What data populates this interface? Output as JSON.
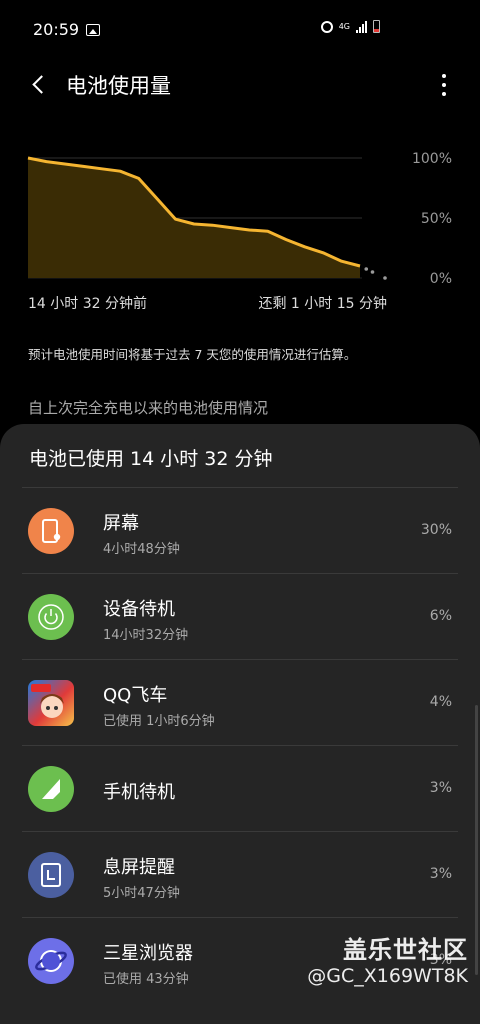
{
  "status_bar": {
    "time": "20:59",
    "network": "4G"
  },
  "header": {
    "title": "电池使用量"
  },
  "chart": {
    "y_labels": [
      "100%",
      "50%",
      "0%"
    ],
    "start_label": "14 小时 32 分钟前",
    "end_label": "还剩 1 小时 15 分钟"
  },
  "chart_data": {
    "type": "line",
    "title": "",
    "xlabel": "",
    "ylabel": "",
    "ylim": [
      0,
      100
    ],
    "x_range_labels": [
      "14 小时 32 分钟前",
      "还剩 1 小时 15 分钟"
    ],
    "series": [
      {
        "values": [
          100,
          97,
          95,
          93,
          91,
          89,
          83,
          66,
          49,
          45,
          44,
          42,
          40,
          39,
          32,
          26,
          21,
          14,
          10
        ]
      },
      {
        "projected_values": [
          10,
          5,
          0
        ]
      }
    ],
    "colors": {
      "line": "#f5b531",
      "area": "#3a2c05"
    },
    "grid": true
  },
  "info": {
    "estimate_note": "预计电池使用时间将基于过去 7 天您的使用情况进行估算。",
    "section_title": "自上次完全充电以来的电池使用情况"
  },
  "sheet": {
    "heading": "电池已使用 14 小时 32 分钟",
    "items": [
      {
        "name": "屏幕",
        "detail": "4小时48分钟",
        "percent": "30%",
        "icon": "screen-icon",
        "color": "#f0844a"
      },
      {
        "name": "设备待机",
        "detail": "14小时32分钟",
        "percent": "6%",
        "icon": "power-icon",
        "color": "#6cbf4f"
      },
      {
        "name": "QQ飞车",
        "detail": "已使用 1小时6分钟",
        "percent": "4%",
        "icon": "qq-speed-app-icon",
        "color": "#1d7be0"
      },
      {
        "name": "手机待机",
        "detail": "",
        "percent": "3%",
        "icon": "signal-icon",
        "color": "#6cbf4f"
      },
      {
        "name": "息屏提醒",
        "detail": "5小时47分钟",
        "percent": "3%",
        "icon": "always-on-display-icon",
        "color": "#4b5fa0"
      },
      {
        "name": "三星浏览器",
        "detail": "已使用 43分钟",
        "percent": "3%",
        "icon": "samsung-internet-icon",
        "color": "#6d6fe8"
      }
    ]
  },
  "watermark": {
    "title": "盖乐世社区",
    "user": "@GC_X169WT8K"
  }
}
